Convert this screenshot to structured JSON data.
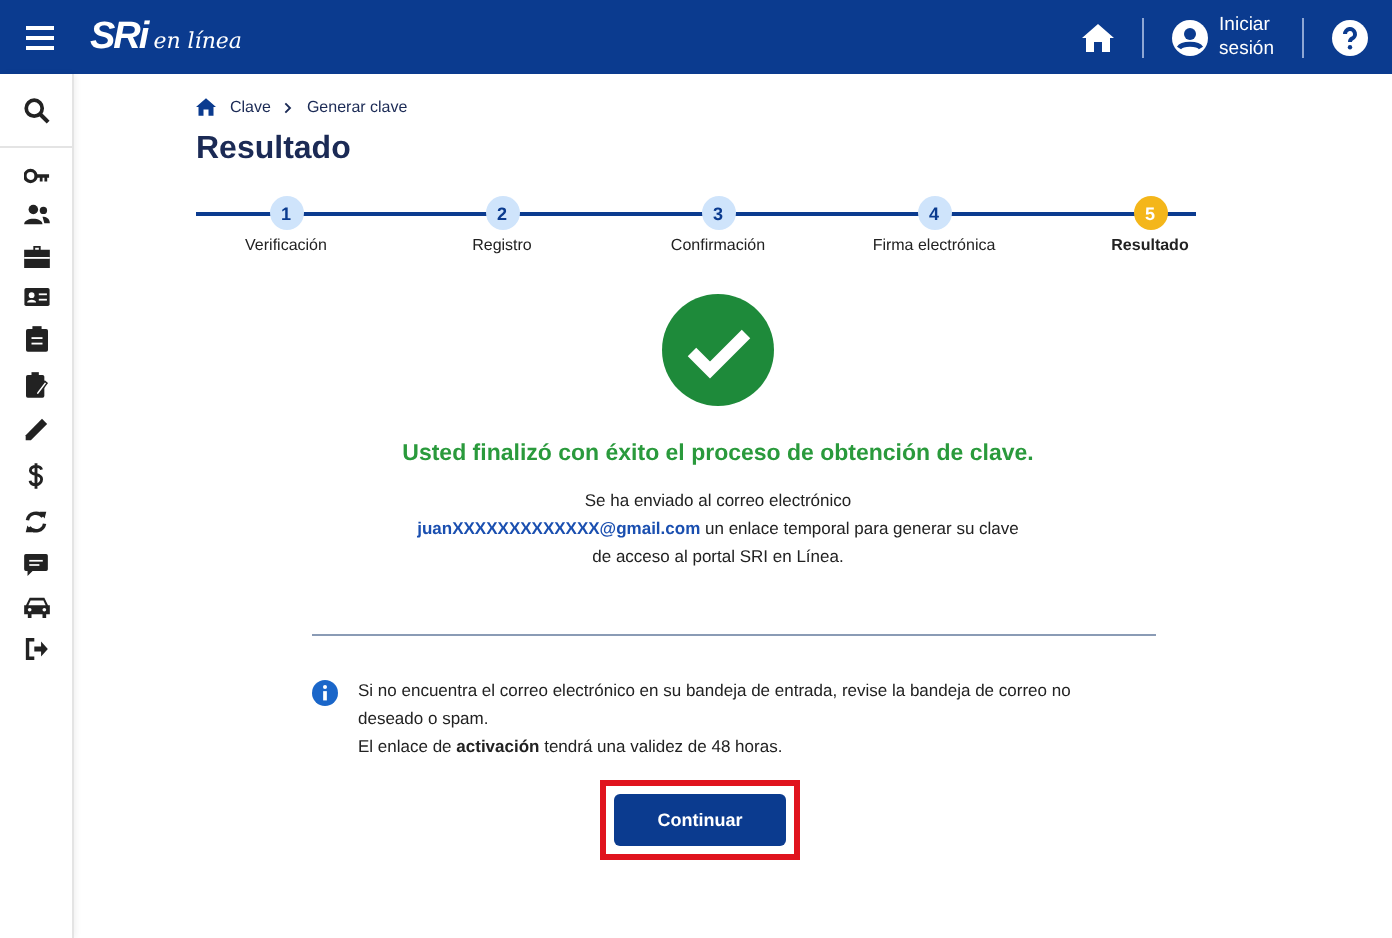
{
  "header": {
    "logo": {
      "brand": "SRi",
      "tagline": "en línea"
    },
    "login": {
      "line1": "Iniciar",
      "line2": "sesión"
    }
  },
  "breadcrumb": [
    "Clave",
    "Generar clave"
  ],
  "title": "Resultado",
  "steps": [
    {
      "number": "1",
      "label": "Verificación",
      "selected": false
    },
    {
      "number": "2",
      "label": "Registro",
      "selected": false
    },
    {
      "number": "3",
      "label": "Confirmación",
      "selected": false
    },
    {
      "number": "4",
      "label": "Firma electrónica",
      "selected": false
    },
    {
      "number": "5",
      "label": "Resultado",
      "selected": true
    }
  ],
  "success_message": "Usted finalizó con éxito el proceso de obtención de clave.",
  "email_message": {
    "before": "Se ha enviado al correo electrónico",
    "email": "juanXXXXXXXXXXXXX@gmail.com",
    "after": "un enlace temporal para generar su clave de acceso al portal SRI en Línea."
  },
  "info_note": [
    "Si no encuentra el correo electrónico en su bandeja de entrada, revise la bandeja de correo no deseado o spam.",
    "El enlace de **activación** tendrá una validez de 48 horas."
  ],
  "button": {
    "label": "Continuar",
    "highlighted": true
  }
}
